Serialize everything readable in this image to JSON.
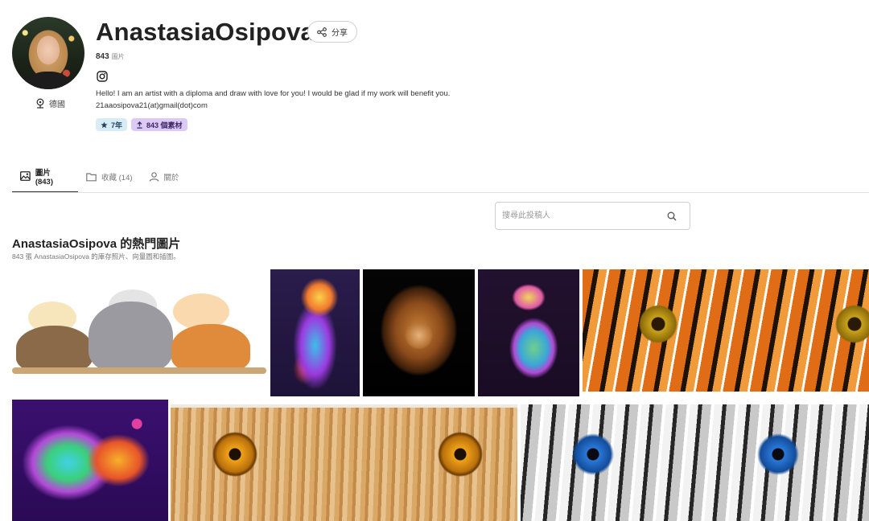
{
  "profile": {
    "name": "AnastasiaOsipova",
    "share_label": "分享",
    "count_value": "843",
    "count_unit": "圖片",
    "location": "德國",
    "bio_line1": "Hello! I am an artist with a diploma and draw with love for you! I would be glad if my work will benefit you.",
    "bio_line2": "21aaosipova21(at)gmail(dot)com",
    "badges": [
      {
        "label": "7年",
        "icon": "star-icon"
      },
      {
        "label": "843 個素材",
        "icon": "upload-icon"
      }
    ]
  },
  "tabs": [
    {
      "label": "圖片 (843)",
      "icon": "image-icon",
      "active": true
    },
    {
      "label": "收藏 (14)",
      "icon": "folder-icon",
      "active": false
    },
    {
      "label": "關於",
      "icon": "user-icon",
      "active": false
    }
  ],
  "search": {
    "placeholder": "搜尋此投稿人",
    "value": ""
  },
  "section": {
    "title": "AnastasiaOsipova 的熱門圖片",
    "subtitle": "843 張 AnastasiaOsipova 的庫存照片、向量圖和插圖。"
  },
  "gallery": [
    {
      "name": "cats-peeking"
    },
    {
      "name": "neon-lion-walking"
    },
    {
      "name": "lion-portrait-black"
    },
    {
      "name": "neon-leopard"
    },
    {
      "name": "tiger-eyes"
    },
    {
      "name": "colorful-lion-couple"
    },
    {
      "name": "lion-eyes"
    },
    {
      "name": "white-tiger-eyes"
    }
  ],
  "colors": {
    "years_badge_bg": "#d6ecf7",
    "assets_badge_bg": "#dccaf5",
    "active_tab_underline": "#333333"
  }
}
